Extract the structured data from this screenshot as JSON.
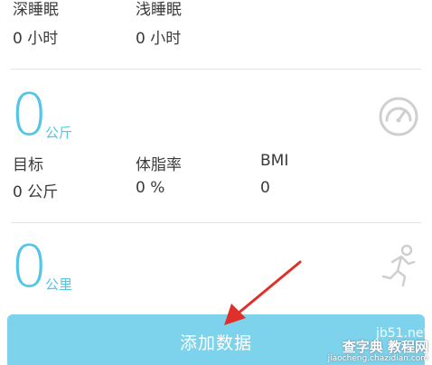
{
  "sleep": {
    "deep_label": "深睡眠",
    "deep_value": "0 小时",
    "light_label": "浅睡眠",
    "light_value": "0 小时"
  },
  "weight": {
    "value": "0",
    "unit": "公斤",
    "icon": "scale-gauge-icon",
    "target_label": "目标",
    "target_value": "0 公斤",
    "bodyfat_label": "体脂率",
    "bodyfat_value": "0 %",
    "bmi_label": "BMI",
    "bmi_value": "0"
  },
  "distance": {
    "value": "0",
    "unit": "公里",
    "icon": "running-person-icon"
  },
  "add_button": {
    "label": "添加数据",
    "color": "#7dd3ec"
  },
  "watermark": {
    "site": "jb51.net",
    "brand": "查字典 教程网",
    "url": "jiaocheng.chazidian.com"
  },
  "colors": {
    "accent": "#53c6e6",
    "icon_gray": "#cfcfcf",
    "arrow": "#e0302b"
  }
}
